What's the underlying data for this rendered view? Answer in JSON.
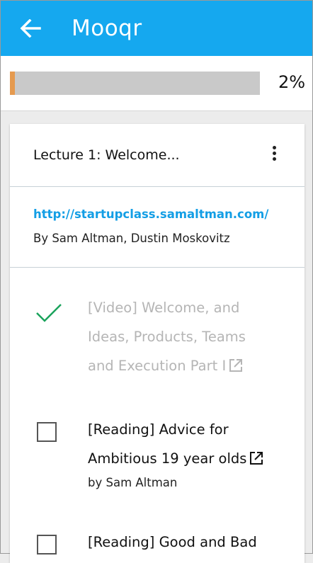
{
  "appbar": {
    "title": "Mooqr",
    "back_icon": "arrow-left-icon"
  },
  "progress": {
    "percent_label": "2%",
    "fraction": 0.02,
    "fill_color": "#e59a4f"
  },
  "lecture": {
    "title": "Lecture 1: Welcome...",
    "link": "http://startupclass.samaltman.com/",
    "authors": "By Sam Altman, Dustin Moskovitz"
  },
  "items": [
    {
      "text": "[Video] Welcome, and Ideas, Products, Teams and Execution Part I",
      "done": true,
      "author": ""
    },
    {
      "text": "[Reading] Advice for Ambitious 19 year olds",
      "done": false,
      "author": "by Sam Altman"
    },
    {
      "text": "[Reading] Good and Bad",
      "done": false,
      "author": ""
    }
  ],
  "colors": {
    "appbar": "#15a8ef",
    "link": "#139ee5",
    "check": "#1aa35c"
  }
}
